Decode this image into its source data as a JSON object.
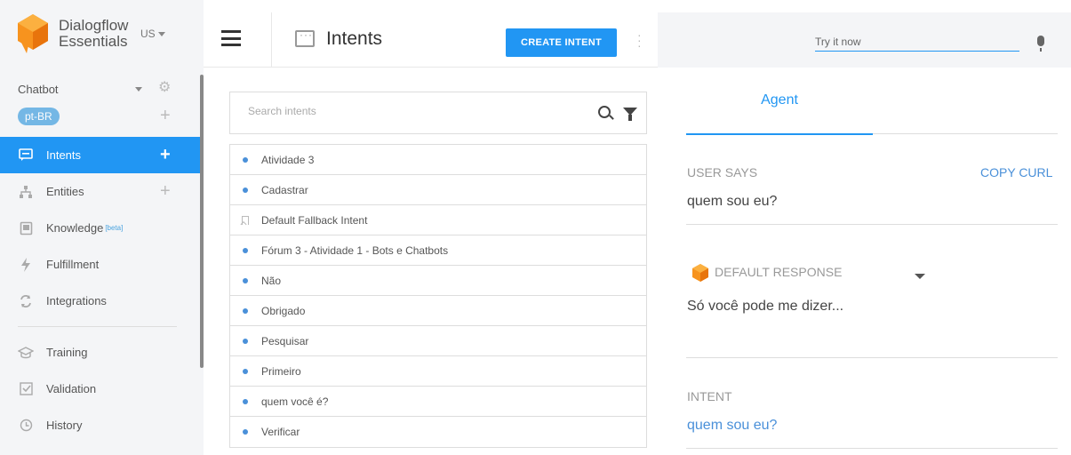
{
  "sidebar": {
    "brand_line1": "Dialogflow",
    "brand_line2": "Essentials",
    "region": "US",
    "agent_name": "Chatbot",
    "language": "pt-BR",
    "items": [
      {
        "label": "Intents",
        "icon": "chat-icon",
        "active": true,
        "plus": true
      },
      {
        "label": "Entities",
        "icon": "entities-icon",
        "active": false,
        "plus": true
      },
      {
        "label": "Knowledge",
        "icon": "knowledge-icon",
        "active": false,
        "badge": "[beta]"
      },
      {
        "label": "Fulfillment",
        "icon": "bolt-icon",
        "active": false
      },
      {
        "label": "Integrations",
        "icon": "integrations-icon",
        "active": false
      },
      {
        "label": "Training",
        "icon": "training-icon",
        "active": false
      },
      {
        "label": "Validation",
        "icon": "validation-icon",
        "active": false
      },
      {
        "label": "History",
        "icon": "history-icon",
        "active": false
      }
    ]
  },
  "header": {
    "title": "Intents",
    "create_button": "CREATE INTENT"
  },
  "intents": {
    "search_placeholder": "Search intents",
    "items": [
      {
        "name": "Atividade 3",
        "type": "dot"
      },
      {
        "name": "Cadastrar",
        "type": "dot"
      },
      {
        "name": "Default Fallback Intent",
        "type": "fallback"
      },
      {
        "name": "Fórum 3 - Atividade 1 - Bots e Chatbots",
        "type": "dot"
      },
      {
        "name": "Não",
        "type": "dot"
      },
      {
        "name": "Obrigado",
        "type": "dot"
      },
      {
        "name": "Pesquisar",
        "type": "dot"
      },
      {
        "name": "Primeiro",
        "type": "dot"
      },
      {
        "name": "quem você é?",
        "type": "dot"
      },
      {
        "name": "Verificar",
        "type": "dot"
      }
    ]
  },
  "test_panel": {
    "try_placeholder": "Try it now",
    "tab": "Agent",
    "user_says_label": "USER SAYS",
    "copy_curl": "COPY CURL",
    "user_says_value": "quem sou eu?",
    "default_response_label": "DEFAULT RESPONSE",
    "default_response_value": "Só você pode me dizer...",
    "intent_label": "INTENT",
    "intent_value": "quem sou eu?"
  },
  "colors": {
    "accent": "#2196f3",
    "logo_orange": "#f7931e",
    "sidebar_bg": "#f4f5f7"
  }
}
